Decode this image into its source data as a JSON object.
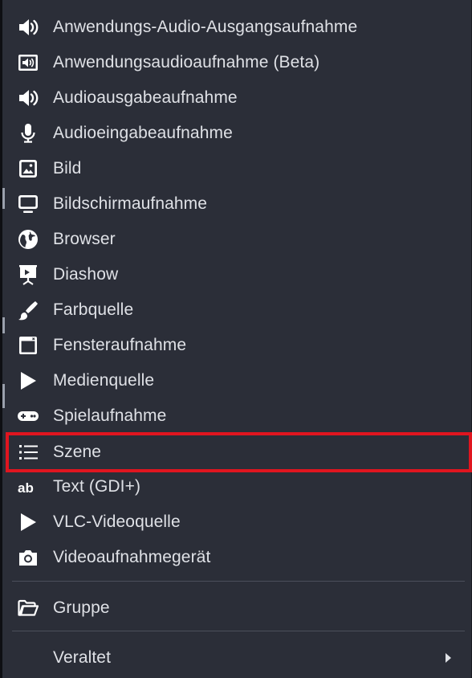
{
  "menu": {
    "items": [
      {
        "label": "Anwendungs-Audio-Ausgangsaufnahme",
        "icon": "speaker-icon"
      },
      {
        "label": "Anwendungsaudioaufnahme (Beta)",
        "icon": "speaker-box-icon"
      },
      {
        "label": "Audioausgabeaufnahme",
        "icon": "speaker-icon"
      },
      {
        "label": "Audioeingabeaufnahme",
        "icon": "microphone-icon"
      },
      {
        "label": "Bild",
        "icon": "image-icon"
      },
      {
        "label": "Bildschirmaufnahme",
        "icon": "monitor-icon"
      },
      {
        "label": "Browser",
        "icon": "globe-icon"
      },
      {
        "label": "Diashow",
        "icon": "presentation-icon"
      },
      {
        "label": "Farbquelle",
        "icon": "paintbrush-icon"
      },
      {
        "label": "Fensteraufnahme",
        "icon": "window-icon"
      },
      {
        "label": "Medienquelle",
        "icon": "play-icon"
      },
      {
        "label": "Spielaufnahme",
        "icon": "gamepad-icon"
      },
      {
        "label": "Szene",
        "icon": "list-icon",
        "highlighted": true
      },
      {
        "label": "Text (GDI+)",
        "icon": "text-ab-icon"
      },
      {
        "label": "VLC-Videoquelle",
        "icon": "play-icon"
      },
      {
        "label": "Videoaufnahmegerät",
        "icon": "camera-icon"
      }
    ],
    "group": {
      "label": "Gruppe",
      "icon": "folder-open-icon"
    },
    "deprecated": {
      "label": "Veraltet",
      "has_submenu": true
    }
  },
  "colors": {
    "background": "#2b2e38",
    "text": "#dfe1e6",
    "highlight_border": "#e0151f",
    "separator": "#4b4f5b"
  }
}
